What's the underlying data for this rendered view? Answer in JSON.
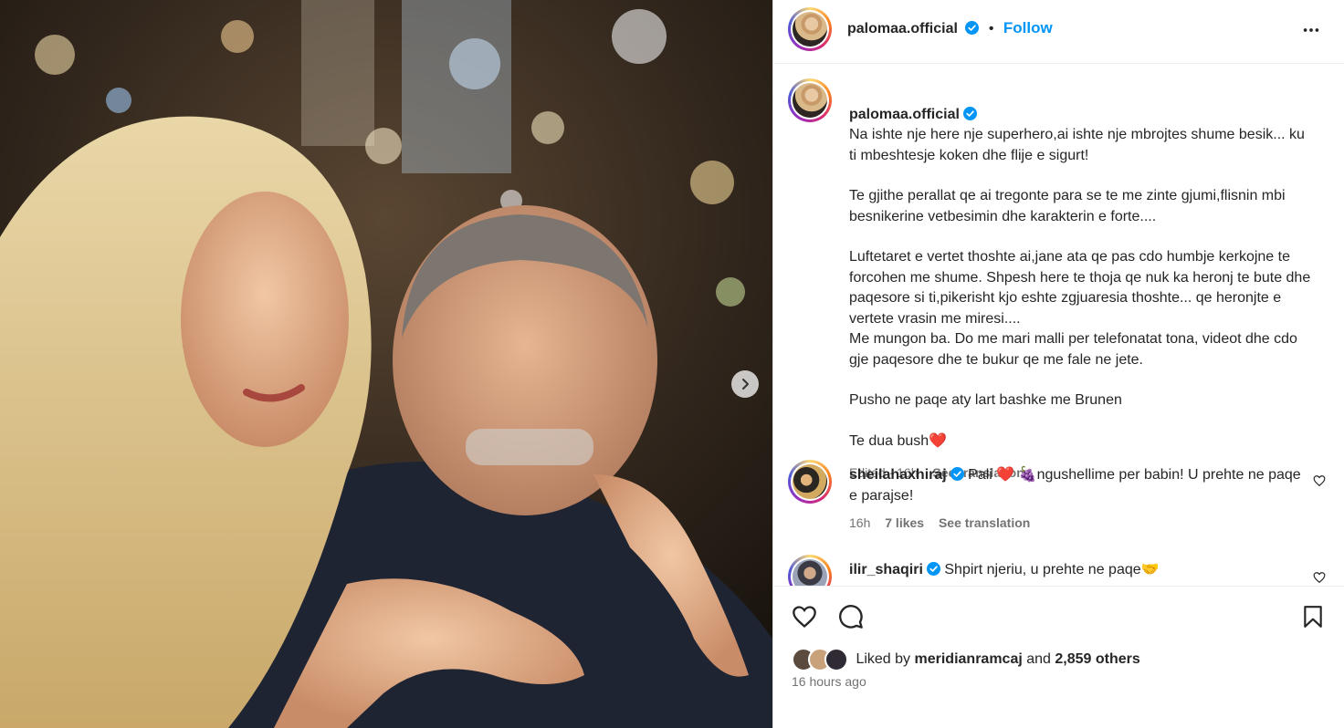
{
  "post": {
    "username": "palomaa.official",
    "dot": "•",
    "follow_label": "Follow",
    "caption": {
      "p1": "Na ishte nje here nje superhero,ai ishte nje mbrojtes shume besik... ku ti mbeshtesje koken dhe flije e sigurt!",
      "p2": "Te gjithe perallat qe ai tregonte para se te me zinte gjumi,flisnin mbi besnikerine vetbesimin dhe karakterin e forte....",
      "p3": "Luftetaret e vertet thoshte ai,jane ata qe pas cdo humbje kerkojne te forcohen me shume. Shpesh here te thoja qe nuk ka heronj te bute dhe paqesore si ti,pikerisht kjo eshte zgjuaresia thoshte... qe heronjte e vertete vrasin me miresi....\nMe mungon ba. Do me mari malli per telefonatat tona, videot dhe cdo gje paqesore dhe te bukur qe me fale ne jete.",
      "p4": "Pusho ne paqe aty lart bashke me Brunen",
      "p5": "Te dua bush❤️"
    },
    "edited": "Edited · 16h",
    "see_translation": "See translation"
  },
  "comments": [
    {
      "username": "sheilahaxhiraj",
      "text": "Pali ❤️ 🍇ngushellime per babin! U prehte ne paqe e parajse!",
      "time": "16h",
      "likes": "7 likes",
      "see_translation": "See translation"
    },
    {
      "username": "ilir_shaqiri",
      "text": "Shpirt njeriu, u prehte ne paqe🤝"
    }
  ],
  "footer": {
    "liked_by_prefix": "Liked by",
    "liked_by_user": "meridianramcaj",
    "and": "and",
    "others": "2,859 others",
    "time_ago": "16 hours ago"
  },
  "colors": {
    "accent": "#0095f6",
    "verified": "#0095f6",
    "text": "#262626",
    "secondary": "#737373"
  },
  "icons": [
    "chevron-right-icon",
    "verified-icon",
    "more-icon",
    "heart-icon",
    "comment-icon",
    "bookmark-icon"
  ]
}
